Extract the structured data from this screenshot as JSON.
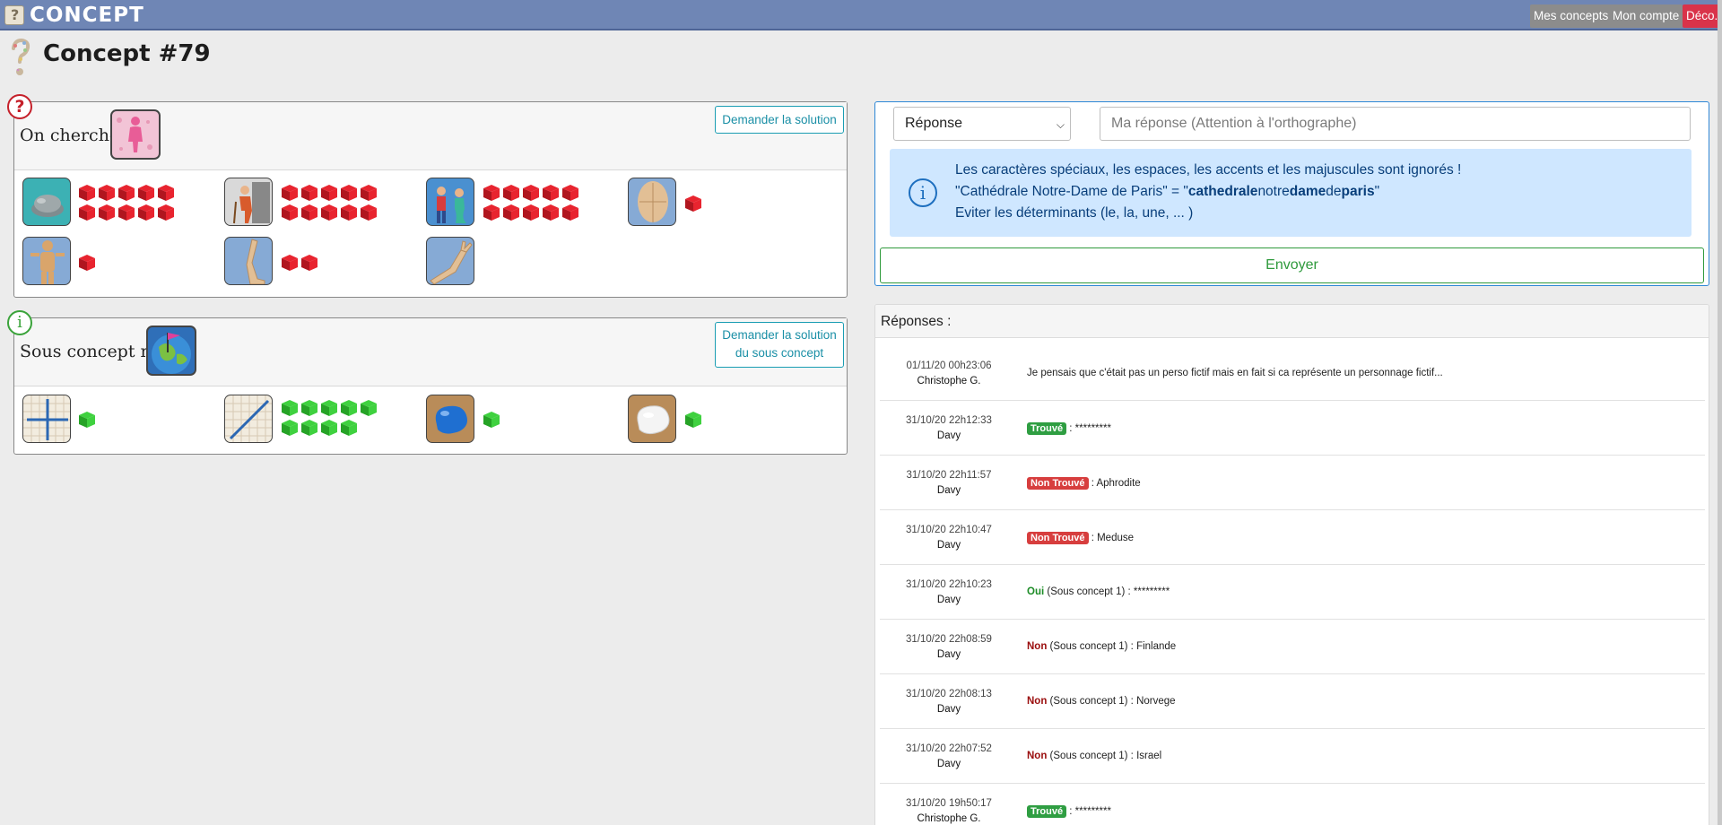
{
  "topbar": {
    "logo_text": "CONCEPT",
    "nav": [
      "Mes concepts",
      "Mon compte",
      "Déco."
    ]
  },
  "page": {
    "title": "Concept #79"
  },
  "search_card": {
    "label": "On cherche :",
    "solution_button": "Demander la solution",
    "badge": "?"
  },
  "sub_card": {
    "label": "Sous concept n°1 :",
    "solution_button_line1": "Demander la solution",
    "solution_button_line2": "du sous concept",
    "badge": "i"
  },
  "colors": {
    "red_cube": "#e8242f",
    "green_cube": "#3fd13f",
    "accent": "#1a9db3"
  },
  "clues": [
    {
      "icon": "stone-icon",
      "count": 10
    },
    {
      "icon": "old-man-icon",
      "count": 10
    },
    {
      "icon": "mermaid-icon",
      "count": 10
    },
    {
      "icon": "face-icon",
      "count": 1
    },
    {
      "icon": "body-icon",
      "count": 1
    },
    {
      "icon": "leg-icon",
      "count": 2
    },
    {
      "icon": "arm-icon",
      "count": 0
    }
  ],
  "sub_clues": [
    {
      "icon": "plus-icon",
      "count": 1
    },
    {
      "icon": "diagonal-line-icon",
      "count": 9
    },
    {
      "icon": "blue-blob-icon",
      "count": 1
    },
    {
      "icon": "white-blob-icon",
      "count": 1
    }
  ],
  "form": {
    "select_value": "Réponse",
    "input_placeholder": "Ma réponse (Attention à l'orthographe)",
    "info_line1": "Les caractères spéciaux, les espaces, les accents et les majuscules sont ignorés !",
    "info_line2_a": "\"Cathédrale Notre-Dame de Paris\" = \"",
    "info_line2_b1": "cathedrale",
    "info_line2_b2": "notre",
    "info_line2_b3": "dame",
    "info_line2_b4": "de",
    "info_line2_b5": "paris",
    "info_line2_c": "\"",
    "info_line3": "Eviter les déterminants (le, la, une, ... )",
    "send": "Envoyer"
  },
  "responses": {
    "title": "Réponses :",
    "rows": [
      {
        "date": "01/11/20 00h23:06",
        "user": "Christophe G.",
        "kind": "comment",
        "text": "Je pensais que c'était pas un perso fictif mais en fait si ca représente un personnage fictif..."
      },
      {
        "date": "31/10/20 22h12:33",
        "user": "Davy",
        "kind": "found",
        "tag": "Trouvé",
        "text": " : *********"
      },
      {
        "date": "31/10/20 22h11:57",
        "user": "Davy",
        "kind": "notfound",
        "tag": "Non Trouvé",
        "text": " : Aphrodite"
      },
      {
        "date": "31/10/20 22h10:47",
        "user": "Davy",
        "kind": "notfound",
        "tag": "Non Trouvé",
        "text": " : Meduse"
      },
      {
        "date": "31/10/20 22h10:23",
        "user": "Davy",
        "kind": "oui",
        "tag": "Oui",
        "text": " (Sous concept 1) : *********"
      },
      {
        "date": "31/10/20 22h08:59",
        "user": "Davy",
        "kind": "non",
        "tag": "Non",
        "text": " (Sous concept 1) : Finlande"
      },
      {
        "date": "31/10/20 22h08:13",
        "user": "Davy",
        "kind": "non",
        "tag": "Non",
        "text": " (Sous concept 1) : Norvege"
      },
      {
        "date": "31/10/20 22h07:52",
        "user": "Davy",
        "kind": "non",
        "tag": "Non",
        "text": " (Sous concept 1) : Israel"
      },
      {
        "date": "31/10/20 19h50:17",
        "user": "Christophe G.",
        "kind": "found",
        "tag": "Trouvé",
        "text": " : *********"
      }
    ]
  }
}
